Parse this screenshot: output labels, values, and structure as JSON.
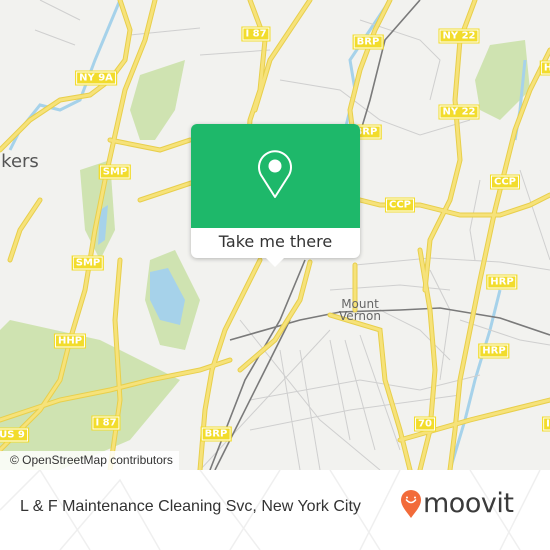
{
  "map": {
    "attribution": "© OpenStreetMap contributors",
    "places": [
      {
        "name": "Yonkers (partial)",
        "label": "kers"
      },
      {
        "name": "Mount Vernon",
        "line1": "Mount",
        "line2": "Vernon"
      }
    ],
    "road_shields": [
      {
        "label": "I 87"
      },
      {
        "label": "BRP"
      },
      {
        "label": "NY 22"
      },
      {
        "label": "NY 9A"
      },
      {
        "label": "BRP"
      },
      {
        "label": "NY 22"
      },
      {
        "label": "SMP"
      },
      {
        "label": "CCP"
      },
      {
        "label": "CCP"
      },
      {
        "label": "SMP"
      },
      {
        "label": "HRP"
      },
      {
        "label": "HHP"
      },
      {
        "label": "HRP"
      },
      {
        "label": "I 87"
      },
      {
        "label": "US 9"
      },
      {
        "label": "BRP"
      },
      {
        "label": "70"
      },
      {
        "label": "H"
      },
      {
        "label": "I"
      }
    ],
    "colors": {
      "road": "#f6e27a",
      "road_edge": "#e8cf4b",
      "water": "#a6d2ea",
      "park": "#cfe3b1",
      "land": "#f2f2ef",
      "minor": "#c9c9c9",
      "rail": "#7a7a7a"
    }
  },
  "popup": {
    "icon": "map-pin-icon",
    "action_label": "Take me there",
    "color": "#1eb86a"
  },
  "footer": {
    "title": "L & F Maintenance Cleaning Svc, New York City",
    "brand": "moovit",
    "brand_icon": "moovit-smile-pin-icon",
    "brand_color": "#f26b3a"
  }
}
